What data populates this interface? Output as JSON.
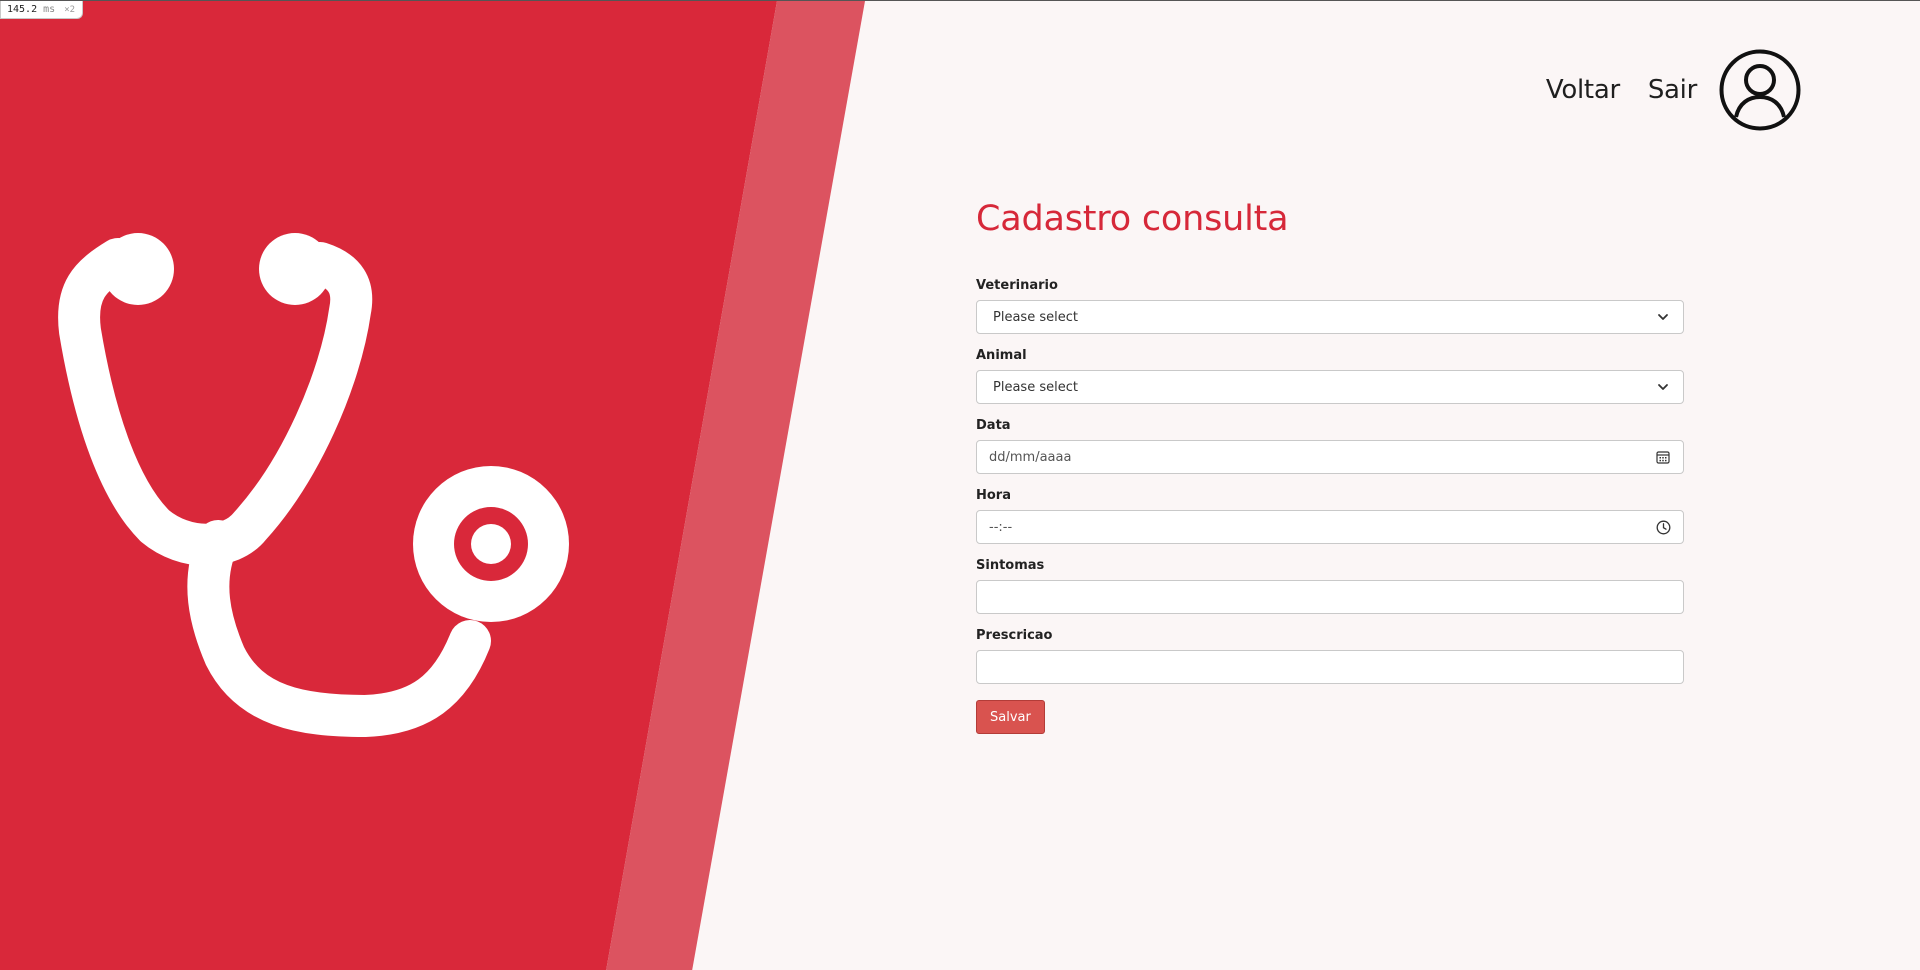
{
  "debug_overlay": {
    "value": "145.2",
    "unit": "ms",
    "multiplier": "×2"
  },
  "header": {
    "back_label": "Voltar",
    "exit_label": "Sair",
    "profile_icon": "user-circle-icon"
  },
  "hero": {
    "icon": "stethoscope-icon"
  },
  "form": {
    "title": "Cadastro consulta",
    "fields": {
      "vet": {
        "label": "Veterinario",
        "value": "Please select"
      },
      "animal": {
        "label": "Animal",
        "value": "Please select"
      },
      "date": {
        "label": "Data",
        "placeholder": "dd/mm/aaaa",
        "icon": "calendar-icon"
      },
      "time": {
        "label": "Hora",
        "placeholder": "--:--",
        "icon": "clock-icon"
      },
      "symptoms": {
        "label": "Sintomas",
        "value": ""
      },
      "prescription": {
        "label": "Prescricao",
        "value": ""
      }
    },
    "submit_label": "Salvar"
  },
  "colors": {
    "brand_red": "#d62839",
    "stripe_pink": "#dc5360",
    "page_bg": "#fbf6f6",
    "button_red": "#d9534f"
  }
}
